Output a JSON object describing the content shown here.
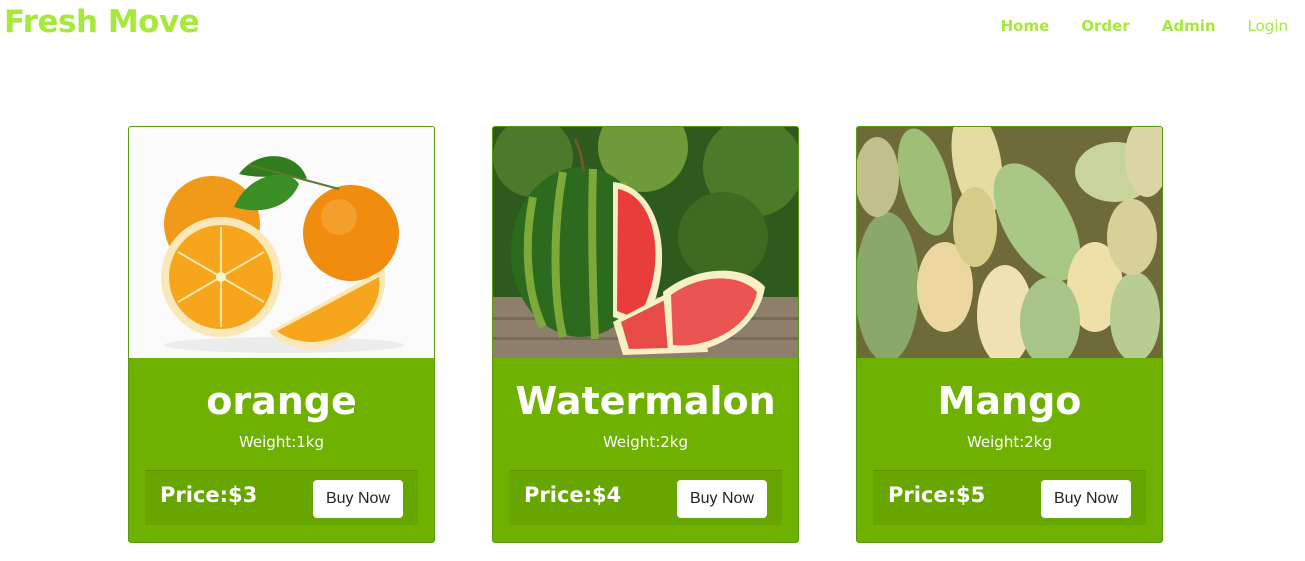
{
  "header": {
    "brand": "Fresh Move"
  },
  "nav": {
    "home": "Home",
    "order": "Order",
    "admin": "Admin",
    "login": "Login"
  },
  "products": [
    {
      "name": "orange",
      "weight": "Weight:1kg",
      "price": "Price:$3",
      "buy_label": "Buy Now"
    },
    {
      "name": "Watermalon",
      "weight": "Weight:2kg",
      "price": "Price:$4",
      "buy_label": "Buy Now"
    },
    {
      "name": "Mango",
      "weight": "Weight:2kg",
      "price": "Price:$5",
      "buy_label": "Buy Now"
    }
  ],
  "colors": {
    "brand": "#a6e83c",
    "card_green": "#6eb100",
    "footer_green": "#67a601",
    "button_bg": "#ffffff"
  }
}
